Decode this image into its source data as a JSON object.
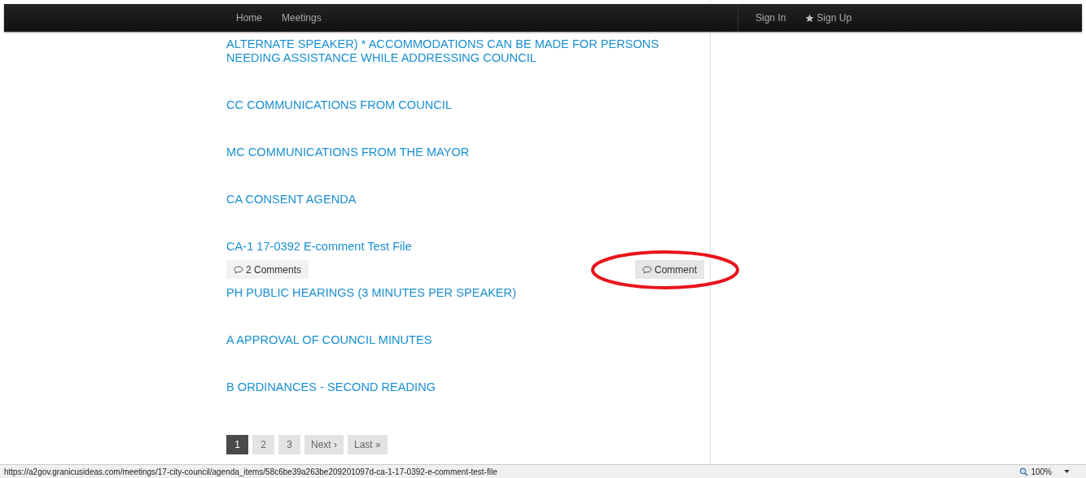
{
  "navbar": {
    "left_links": [
      {
        "label": "Home"
      },
      {
        "label": "Meetings"
      }
    ],
    "right_links": [
      {
        "label": "Sign In",
        "kind": "plain"
      },
      {
        "label": "Sign Up",
        "kind": "star"
      }
    ]
  },
  "agenda_items": [
    {
      "title": "ALTERNATE SPEAKER) * ACCOMMODATIONS CAN BE MADE FOR PERSONS NEEDING ASSISTANCE WHILE ADDRESSING COUNCIL"
    },
    {
      "title": "CC COMMUNICATIONS FROM COUNCIL"
    },
    {
      "title": "MC COMMUNICATIONS FROM THE MAYOR"
    },
    {
      "title": "CA CONSENT AGENDA"
    },
    {
      "title": "CA-1 17-0392 E-comment Test File",
      "comments": {
        "count_label": "2 Comments",
        "comment_label": "Comment",
        "highlighted": true
      }
    },
    {
      "title": "PH PUBLIC HEARINGS (3 MINUTES PER SPEAKER)"
    },
    {
      "title": "A APPROVAL OF COUNCIL MINUTES"
    },
    {
      "title": "B ORDINANCES - SECOND READING"
    }
  ],
  "pagination": [
    {
      "label": "1",
      "selected": true
    },
    {
      "label": "2",
      "selected": false
    },
    {
      "label": "3",
      "selected": false
    },
    {
      "label": "Next ›",
      "selected": false
    },
    {
      "label": "Last »",
      "selected": false
    }
  ],
  "status_bar": {
    "url": "https://a2gov.granicusideas.com/meetings/17-city-council/agenda_items/58c6be39a263be209201097d-ca-1-17-0392-e-comment-test-file",
    "zoom": "100%"
  }
}
